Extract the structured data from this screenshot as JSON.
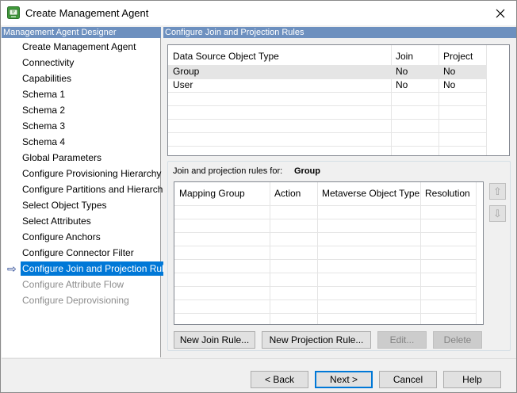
{
  "window": {
    "title": "Create Management Agent"
  },
  "left_panel": {
    "header": "Management Agent Designer",
    "items": [
      {
        "label": "Create Management Agent",
        "state": "normal"
      },
      {
        "label": "Connectivity",
        "state": "normal"
      },
      {
        "label": "Capabilities",
        "state": "normal"
      },
      {
        "label": "Schema 1",
        "state": "normal"
      },
      {
        "label": "Schema 2",
        "state": "normal"
      },
      {
        "label": "Schema 3",
        "state": "normal"
      },
      {
        "label": "Schema 4",
        "state": "normal"
      },
      {
        "label": "Global Parameters",
        "state": "normal"
      },
      {
        "label": "Configure Provisioning Hierarchy",
        "state": "normal"
      },
      {
        "label": "Configure Partitions and Hierarchies",
        "state": "normal"
      },
      {
        "label": "Select Object Types",
        "state": "normal"
      },
      {
        "label": "Select Attributes",
        "state": "normal"
      },
      {
        "label": "Configure Anchors",
        "state": "normal"
      },
      {
        "label": "Configure Connector Filter",
        "state": "normal"
      },
      {
        "label": "Configure Join and Projection Rules",
        "state": "selected"
      },
      {
        "label": "Configure Attribute Flow",
        "state": "disabled"
      },
      {
        "label": "Configure Deprovisioning",
        "state": "disabled"
      }
    ]
  },
  "right_panel": {
    "header": "Configure Join and Projection Rules",
    "object_table": {
      "columns": [
        "Data Source Object Type",
        "Join",
        "Project"
      ],
      "rows": [
        [
          "Group",
          "No",
          "No"
        ],
        [
          "User",
          "No",
          "No"
        ]
      ]
    },
    "rules": {
      "label": "Join and projection rules for:",
      "selected_type": "Group",
      "columns": [
        "Mapping Group",
        "Action",
        "Metaverse Object Type",
        "Resolution"
      ],
      "rows": []
    },
    "buttons": {
      "new_join_rule": "New Join Rule...",
      "new_projection_rule": "New Projection Rule...",
      "edit": "Edit...",
      "delete": "Delete"
    }
  },
  "footer": {
    "back": "< Back",
    "next": "Next >",
    "cancel": "Cancel",
    "help": "Help"
  },
  "colors": {
    "header_bg": "#6d90bf",
    "selection": "#0078d7"
  }
}
